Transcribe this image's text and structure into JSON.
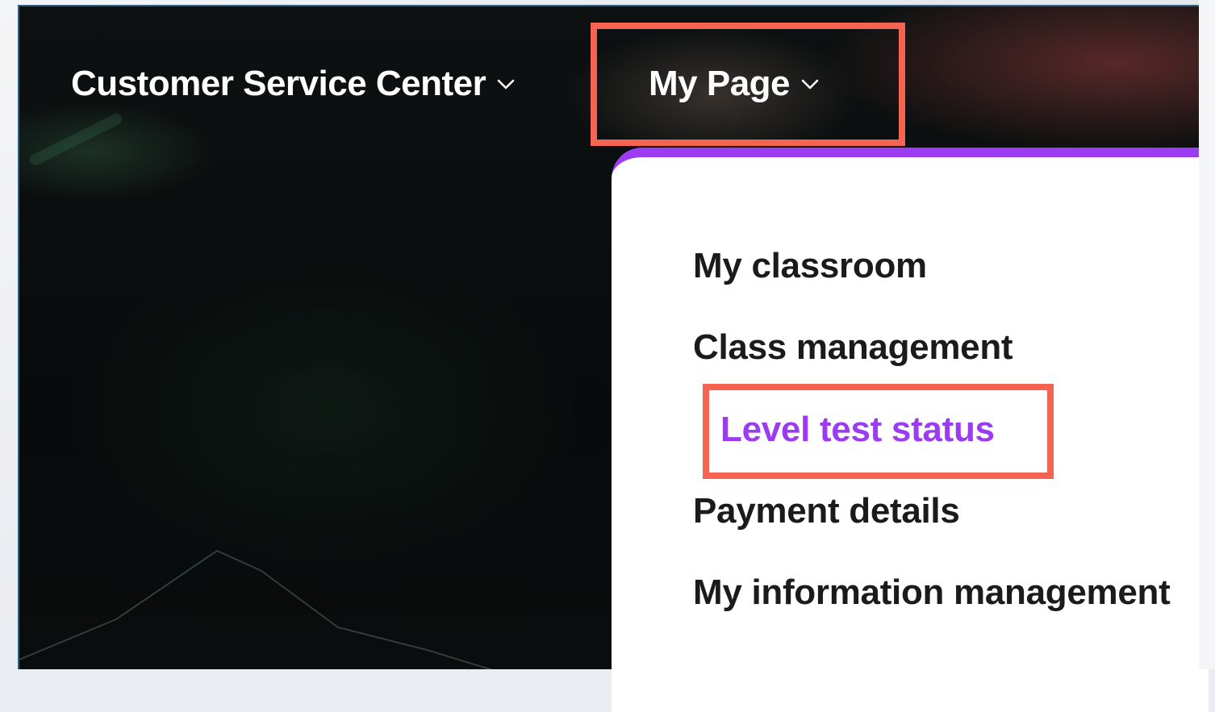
{
  "nav": {
    "items": [
      {
        "label": "Customer Service Center",
        "icon": "chevron-down-icon"
      },
      {
        "label": "My Page",
        "icon": "chevron-down-icon"
      }
    ]
  },
  "dropdown": {
    "items": [
      {
        "label": "My classroom"
      },
      {
        "label": "Class management"
      },
      {
        "label": "Level test status",
        "active": true
      },
      {
        "label": "Payment details"
      },
      {
        "label": "My information management"
      }
    ]
  },
  "colors": {
    "accent_purple": "#9b3cf3",
    "highlight_box": "#f46451",
    "nav_text": "#ffffff",
    "menu_text": "#1b1b1b"
  }
}
